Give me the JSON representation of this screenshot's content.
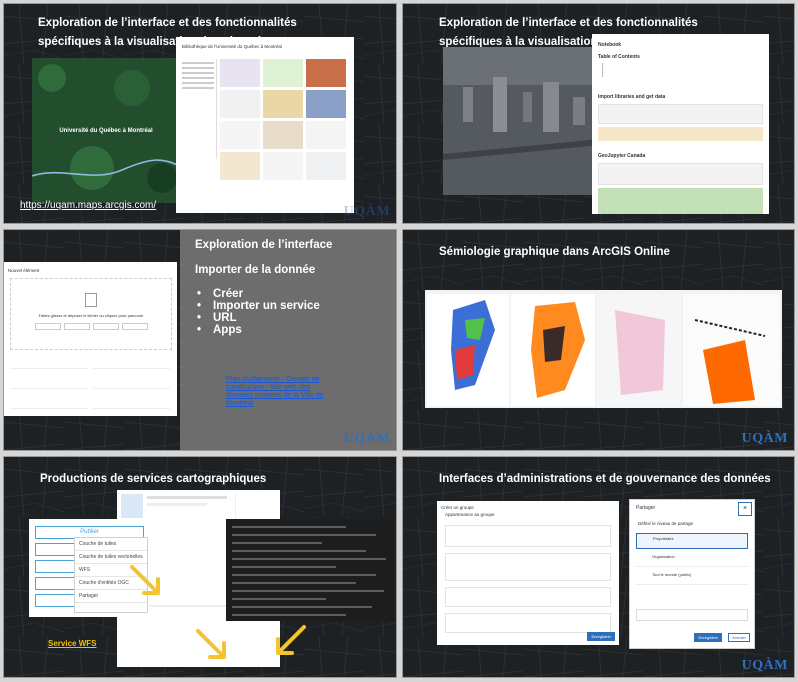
{
  "slides": {
    "s1": {
      "title": "Exploration de l’interface et des fonctionnalités spécifiques à la visualisation dans le web",
      "map_label": "Université du Québec à Montréal",
      "link": "https://uqam.maps.arcgis.com/",
      "gallery_title": "Bibliothèque de l'Université du Québec à Montréal",
      "logo": "UQÀM"
    },
    "s2": {
      "title": "Exploration de l’interface et des fonctionnalités spécifiques à la visualisation dans le web",
      "notebook_h1": "Notebook",
      "notebook_toc": "Table of Contents",
      "notebook_h2": "Import libraries and get data",
      "notebook_h3": "GeoJupyter Canada"
    },
    "s3": {
      "title": "Exploration de l’interface",
      "subtitle": "Importer de la donnée",
      "bullets": [
        "Créer",
        "Importer un service",
        "URL",
        "Apps"
      ],
      "link": "Plan d'urbanisme - Densité de construction - Site web des données ouvertes de la Ville de Montréal",
      "dialog_title": "Nouvel élément",
      "drop_text": "Faites glisser et déposer le fichier ou cliquez pour parcourir",
      "logo": "UQÀM"
    },
    "s4": {
      "title": "Sémiologie graphique dans ArcGIS Online",
      "logo": "UQÀM"
    },
    "s5": {
      "title": "Productions de services cartographiques",
      "menu": [
        "Publier",
        "Créer un",
        "Exporte",
        "Métado",
        "Partager"
      ],
      "dropdown": [
        "Couche de tuiles",
        "Couche de tuiles vectorielles",
        "WFS",
        "Couche d'entités OGC",
        "Partager"
      ],
      "link": "Service WFS"
    },
    "s6": {
      "title": "Interfaces d’administrations et de gouvernance des données",
      "group_title": "Créer un groupe",
      "group_sub": "Appartenance au groupe",
      "share_title": "Partager",
      "share_sub": "Définir le niveau de partage",
      "share_options": [
        "Propriétaire",
        "Organisation",
        "Tout le monde (public)"
      ],
      "share_button": "Enregistrer",
      "cancel_button": "Annuler",
      "save_button": "Enregistrer",
      "logo": "UQÀM"
    }
  },
  "colors": {
    "dark_bg": "#1e2124",
    "gray_panel": "#6d6d6d",
    "logo_blue": "#2f6fc2",
    "link_yellow": "#f2c200",
    "arrow_yellow": "#f4c430",
    "forest": "#1f4a2a"
  }
}
